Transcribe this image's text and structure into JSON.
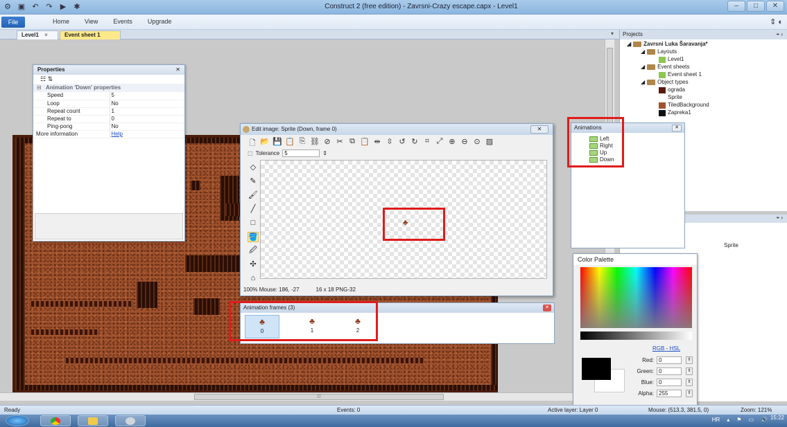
{
  "titlebar": {
    "title": "Construct 2 (free edition) - Zavrsni-Crazy escape.capx - Level1"
  },
  "menu": {
    "file": "File",
    "tabs": [
      "Home",
      "View",
      "Events",
      "Upgrade"
    ]
  },
  "doc_tabs": [
    {
      "label": "Level1",
      "close": "×"
    },
    {
      "label": "Event sheet 1"
    }
  ],
  "properties": {
    "title": "Properties",
    "group": "Animation 'Down' properties",
    "rows": [
      {
        "key": "Speed",
        "value": "5"
      },
      {
        "key": "Loop",
        "value": "No"
      },
      {
        "key": "Repeat count",
        "value": "1"
      },
      {
        "key": "Repeat to",
        "value": "0"
      },
      {
        "key": "Ping-pong",
        "value": "No"
      }
    ],
    "more_info_label": "More information",
    "more_info_link": "Help"
  },
  "edit_image": {
    "title": "Edit image: Sprite (Down, frame 0)",
    "tolerance_label": "Tolerance",
    "tolerance_value": "5",
    "status_zoom": "100%",
    "status_mouse": "Mouse: 186, -27",
    "status_size": "16 x 18",
    "status_format": "PNG-32"
  },
  "animation_frames": {
    "title": "Animation frames (3)",
    "frames": [
      "0",
      "1",
      "2"
    ]
  },
  "animations": {
    "title": "Animations",
    "items": [
      "Left",
      "Right",
      "Up",
      "Down"
    ]
  },
  "color_palette": {
    "title": "Color Palette",
    "mode_rgb": "RGB",
    "mode_sep": "-",
    "mode_hsl": "HSL",
    "red_label": "Red:",
    "red": "0",
    "green_label": "Green:",
    "green": "0",
    "blue_label": "Blue:",
    "blue": "0",
    "alpha_label": "Alpha:",
    "alpha": "255"
  },
  "projects": {
    "title": "Projects",
    "root": "Zavrsni Luka Šaravanja*",
    "layouts_folder": "Layouts",
    "layout_item": "Level1",
    "eventsheets_folder": "Event sheets",
    "eventsheet_item": "Event sheet 1",
    "objecttypes_folder": "Object types",
    "objects": [
      "ograda",
      "Sprite",
      "TiledBackground",
      "Zapreka1"
    ]
  },
  "objects_panel": {
    "sprite_label": "Sprite"
  },
  "statusbar": {
    "ready": "Ready",
    "events": "Events: 0",
    "active_layer": "Active layer: Layer 0",
    "mouse": "Mouse: (513.3, 381.5, 0)",
    "zoom": "Zoom: 121%"
  },
  "taskbar": {
    "lang": "HR",
    "time": "15:22"
  },
  "colors": {
    "highlight": "#e01b1b",
    "level_bg": "#a0522d",
    "wall": "#2a0e06"
  }
}
